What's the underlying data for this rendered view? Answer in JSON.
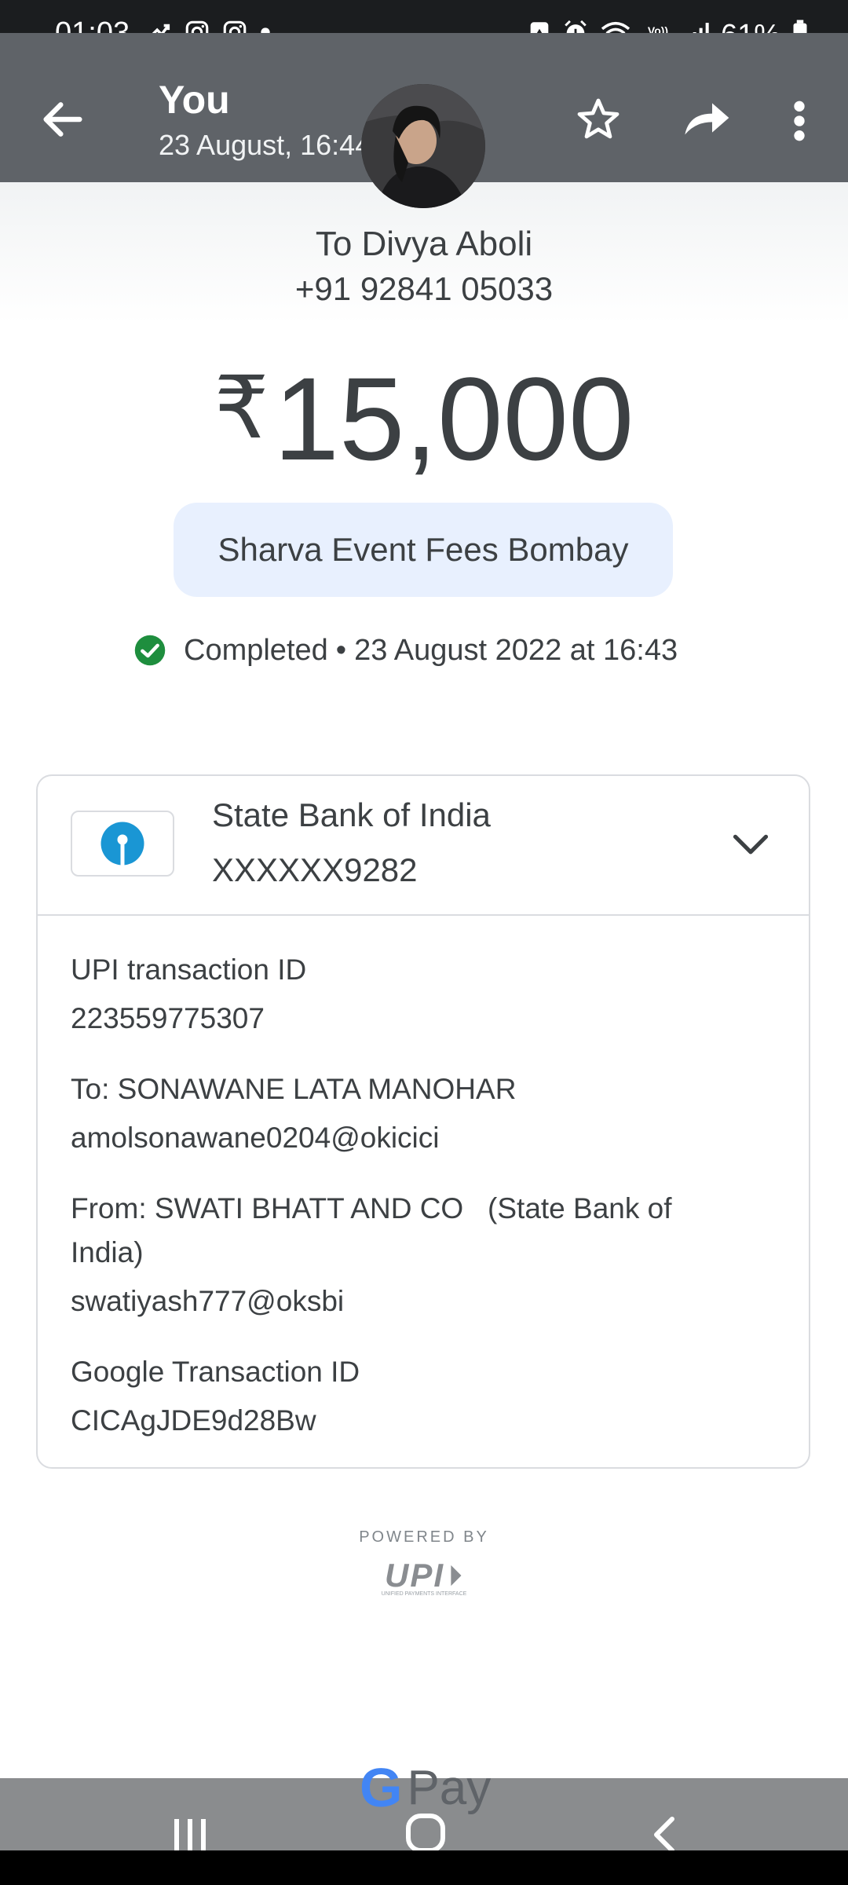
{
  "status_bar": {
    "time": "01:03",
    "battery": "61%",
    "icons": [
      "missed-call-icon",
      "instagram-icon",
      "instagram-icon",
      "dot-icon",
      "battery-saver-icon",
      "alarm-icon",
      "wifi-icon",
      "volte-icon",
      "signal-icon",
      "battery-icon"
    ],
    "volte_label": "Vo)) LTE1"
  },
  "app_bar": {
    "title": "You",
    "subtitle": "23 August, 16:44",
    "actions": [
      "back-arrow-icon",
      "star-icon",
      "share-icon",
      "more-vert-icon"
    ]
  },
  "payment": {
    "recipient_line": "To Divya Aboli",
    "phone": "+91 92841 05033",
    "currency_symbol": "₹",
    "amount": "15,000",
    "note": "Sharva Event Fees Bombay",
    "status": "Completed",
    "status_separator": "•",
    "datetime": "23 August 2022 at 16:43"
  },
  "bank": {
    "name": "State Bank of India",
    "account": "XXXXXX9282",
    "icon": "sbi-logo-icon"
  },
  "details": {
    "upi_label": "UPI transaction ID",
    "upi_value": "223559775307",
    "to_label": "To: SONAWANE LATA MANOHAR",
    "to_value": "amolsonawane0204@okicici",
    "from_label_1": "From: SWATI BHATT AND CO   (State Bank of",
    "from_label_2": "India)",
    "from_value": "swatiyash777@oksbi",
    "google_label": "Google Transaction ID",
    "google_value": "CICAgJDE9d28Bw"
  },
  "footer": {
    "powered_by": "POWERED BY",
    "upi_logo": "UPI",
    "upi_tagline": "UNIFIED PAYMENTS INTERFACE",
    "gpay_g": "G",
    "gpay_text": "Pay"
  },
  "colors": {
    "app_bar": "#5f6368",
    "status_bar": "#1b1d1f",
    "note_bg": "#e8f0fe",
    "success_green": "#1e8e3e",
    "sbi_blue": "#1a96d4",
    "text": "#3c4043"
  }
}
